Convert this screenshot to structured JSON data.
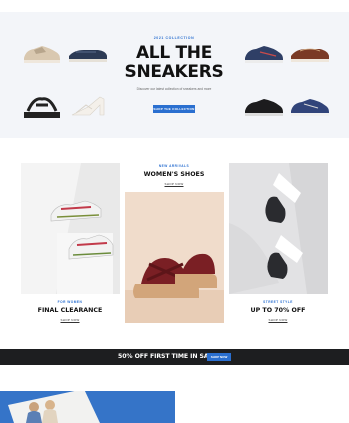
{
  "hero": {
    "eyebrow": "2021 COLLECTION",
    "title": "ALL THE SNEAKERS",
    "description": "Discover our latest collection of sneakers and more",
    "button": "SHOP THE COLLECTION"
  },
  "tiles": [
    {
      "eyebrow": "FOR WOMEN",
      "title": "FINAL CLEARANCE",
      "link": "SHOP NOW"
    },
    {
      "eyebrow": "NEW ARRIVALS",
      "title": "WOMEN'S SHOES",
      "link": "SHOP NOW"
    },
    {
      "eyebrow": "STREET STYLE",
      "title": "UP TO 70% OFF",
      "link": "SHOP NOW"
    }
  ],
  "banner": {
    "text": "50% OFF FIRST TIME IN SALE",
    "button": "SHOP NOW"
  },
  "colors": {
    "accent": "#2a6fd0",
    "hero_bg": "#f3f5f9",
    "banner_bg": "#1d1e20",
    "bottom_image_bg": "#3574c8"
  }
}
